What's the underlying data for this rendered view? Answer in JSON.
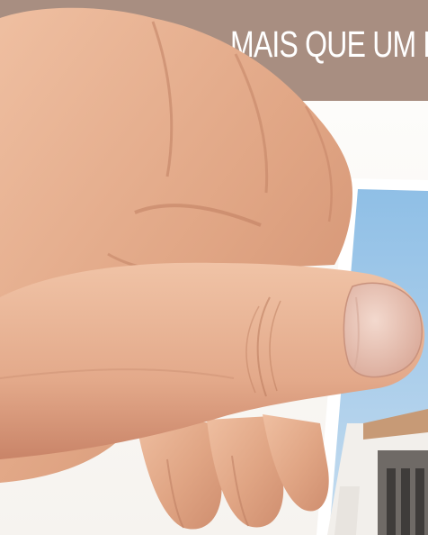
{
  "headline": "MAIS QUE UM BA",
  "colors": {
    "band": "#a88e81",
    "headline_text": "#ffffff",
    "sky": "#a9cdec",
    "skin": "#e2ab8c",
    "skin_shadow": "#c6876a",
    "nail": "#e7c6b8",
    "house_wall": "#f3f1ee",
    "roof": "#c79a76"
  },
  "icons": [
    "hand-holding-photo",
    "house-photo"
  ]
}
